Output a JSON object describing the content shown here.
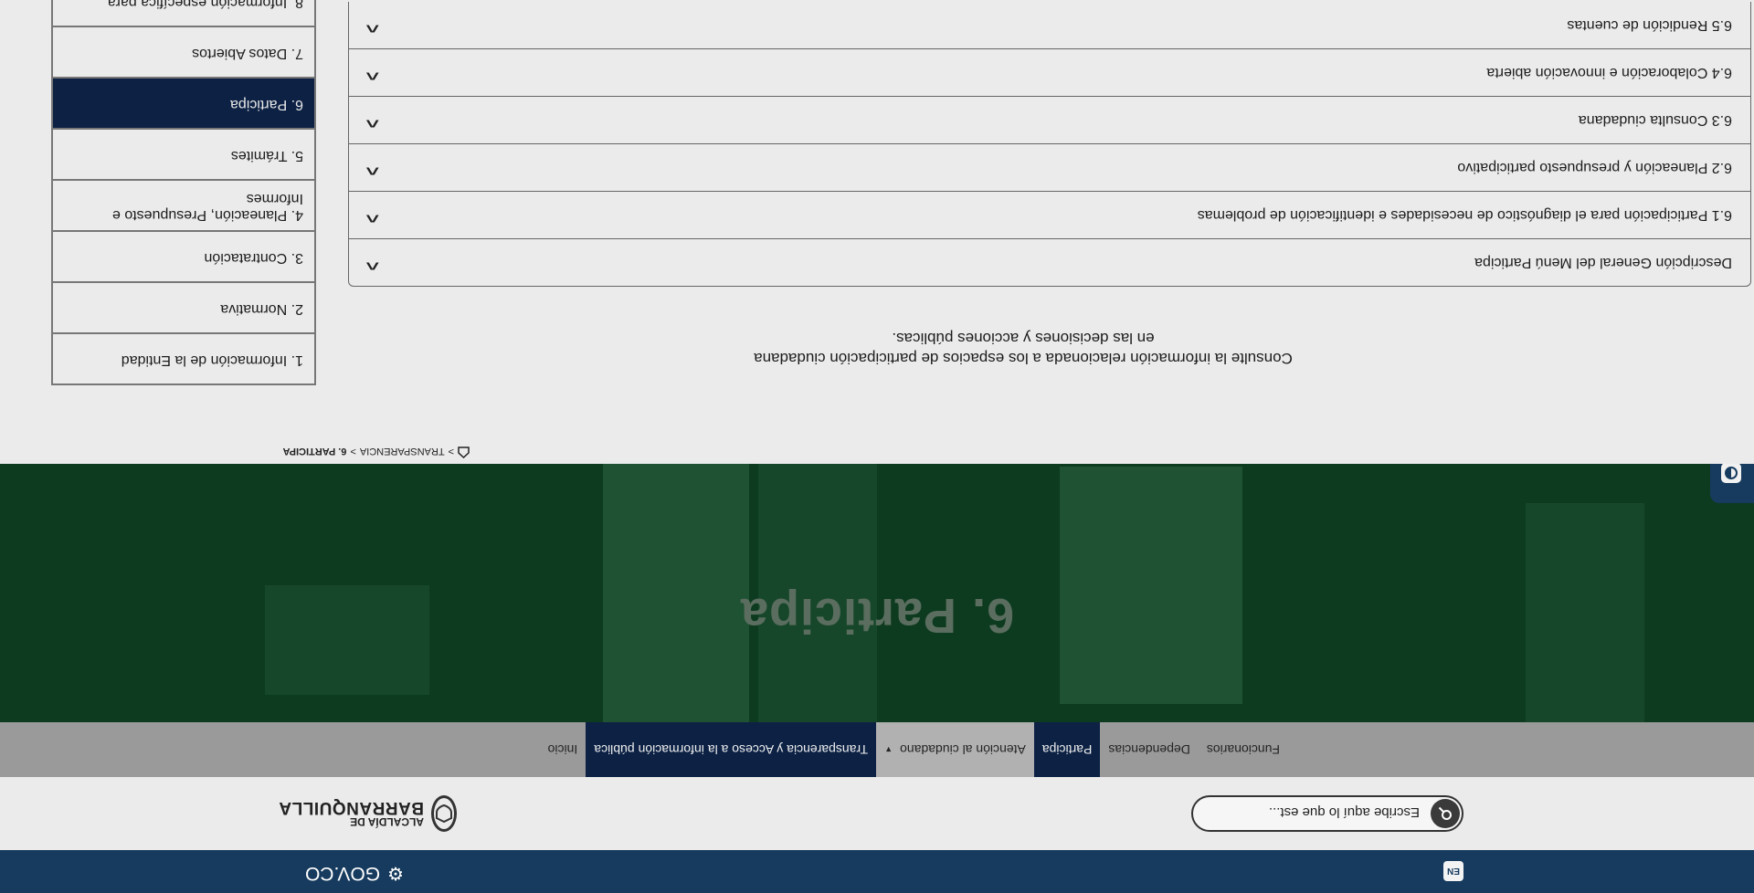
{
  "gov_bar": {
    "lang_label": "EN",
    "gov_mark": "⚙",
    "gov_label": "GOV.CO"
  },
  "header": {
    "search_placeholder": "Escribe aquí lo que est...",
    "search_icon": "search-icon",
    "logo_small": "ALCALDÍA DE",
    "logo_big": "BARRANQUILLA"
  },
  "nav": {
    "items": [
      {
        "label": "Inicio"
      },
      {
        "label": "Transparencia y Acceso a la información pública"
      },
      {
        "label": "Atención al ciudadano",
        "caret": "▼"
      },
      {
        "label": "Participa"
      },
      {
        "label": "Dependencias"
      },
      {
        "label": "Funcionarios"
      }
    ]
  },
  "hero": {
    "title": "6. Participa"
  },
  "accessibility": {
    "icons": [
      "contrast-icon",
      "font-decrease-icon",
      "font-increase-icon",
      "sign-language-icon"
    ]
  },
  "breadcrumb": {
    "home_icon": "home-icon",
    "sep": ">",
    "level1": "TRANSPARENCIA",
    "current": "6. PARTICIPA"
  },
  "intro": {
    "line1": "Consulte la información relacionada a los espacios de participación ciudadana",
    "line2": "en las decisiones y acciones públicas."
  },
  "accordion": {
    "items": [
      {
        "label": "Descripción General del Menú Participa"
      },
      {
        "label": "6.1 Participación para el diagnóstico de necesidades e identificación de problemas"
      },
      {
        "label": "6.2 Planeación y presupuesto participativo"
      },
      {
        "label": "6.3 Consulta ciudadana"
      },
      {
        "label": "6.4 Colaboración e innovación abierta"
      },
      {
        "label": "6.5 Rendición de cuentas"
      }
    ],
    "chevron": "^"
  },
  "sidebar": {
    "items": [
      {
        "label": "1. Información de la Entidad"
      },
      {
        "label": "2. Normativa"
      },
      {
        "label": "3. Contratación"
      },
      {
        "label": "4. Planeación, Presupuesto e Informes"
      },
      {
        "label": "5. Trámites"
      },
      {
        "label": "6. Participa"
      },
      {
        "label": "7. Datos Abiertos"
      },
      {
        "label": "8. Información específica para"
      }
    ]
  }
}
